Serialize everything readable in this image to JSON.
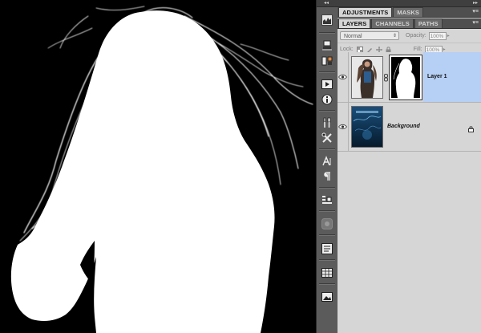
{
  "canvas": {
    "description_icon": "white-silhouette-mask"
  },
  "dock": {
    "icons": [
      "histogram-icon",
      "stamp-icon",
      "clone-icon",
      "actions-icon",
      "info-icon",
      "brush-presets-icon",
      "tool-presets-icon",
      "character-icon",
      "paragraph-icon",
      "layer-comps-icon",
      "navigator-icon",
      "adjustments-list-icon",
      "grid-icon",
      "image-icon"
    ]
  },
  "panel_top": {
    "tabs": [
      {
        "label": "ADJUSTMENTS",
        "active": true
      },
      {
        "label": "MASKS",
        "active": false
      }
    ]
  },
  "layers_panel": {
    "tabs": [
      {
        "label": "LAYERS",
        "active": true
      },
      {
        "label": "CHANNELS",
        "active": false
      },
      {
        "label": "PATHS",
        "active": false
      }
    ],
    "blend_mode": "Normal",
    "opacity_label": "Opacity:",
    "opacity_value": "100%",
    "lock_label": "Lock:",
    "fill_label": "Fill:",
    "fill_value": "100%",
    "layers": [
      {
        "name": "Layer 1",
        "selected": true,
        "has_mask": true,
        "visible": true
      },
      {
        "name": "Background",
        "selected": false,
        "locked": true,
        "visible": true
      }
    ]
  },
  "colors": {
    "selection": "#b6cff4",
    "panel_bg": "#d6d6d6",
    "dock_bg": "#5b5b5b"
  }
}
